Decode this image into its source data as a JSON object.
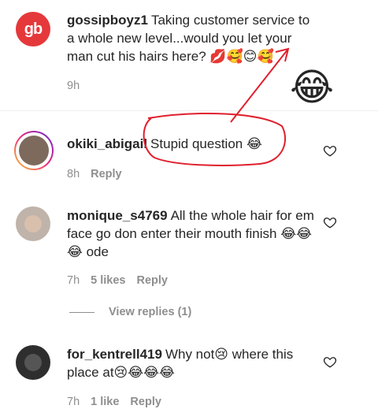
{
  "comments": [
    {
      "username": "gossipboyz1",
      "avatar_text": "gb",
      "text": "Taking customer service to a whole new level...would you let your man cut his hairs here? 💋🥰😊🥰",
      "time": "9h"
    },
    {
      "username": "okiki_abigail",
      "text": "Stupid question 😂",
      "time": "8h",
      "reply_label": "Reply"
    },
    {
      "username": "monique_s4769",
      "text": "All the whole hair for em face go don enter their mouth finish 😂😂😂 ode",
      "time": "7h",
      "likes": "5 likes",
      "reply_label": "Reply"
    },
    {
      "username": "for_kentrell419",
      "text": "Why not😢 where this place at😢😂😂😂",
      "time": "7h",
      "likes": "1 like",
      "reply_label": "Reply"
    }
  ],
  "view_replies_label": "View replies (1)",
  "annotation": {
    "emoji": "😂",
    "color": "#e0202e"
  }
}
